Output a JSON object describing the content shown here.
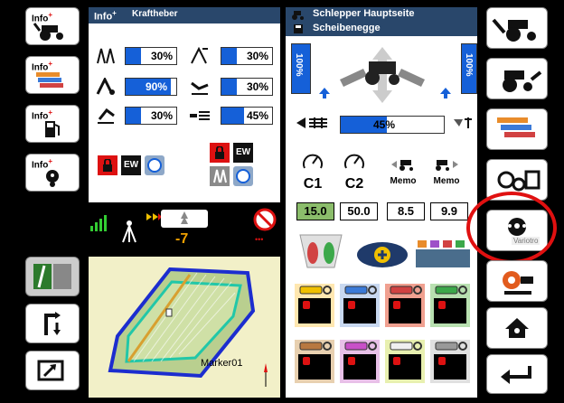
{
  "left_panel": {
    "info_label": "Info",
    "info_sup": "+",
    "title": "Kraftheber",
    "bars": [
      {
        "value": "30%",
        "fraction": 0.3
      },
      {
        "value": "90%",
        "fraction": 0.9
      },
      {
        "value": "30%",
        "fraction": 0.3
      },
      {
        "value": "30%",
        "fraction": 0.3
      },
      {
        "value": "30%",
        "fraction": 0.3
      },
      {
        "value": "45%",
        "fraction": 0.45
      }
    ],
    "ew_label": "EW",
    "ew_label_2": "EW"
  },
  "left_buttons": [
    {
      "label": "Info",
      "sup": "+"
    },
    {
      "label": "Info",
      "sup": "+"
    },
    {
      "label": "Info",
      "sup": "+"
    },
    {
      "label": "Info",
      "sup": "+"
    }
  ],
  "status": {
    "offset_value": "-7",
    "signal_icon": "signal-bars"
  },
  "map": {
    "marker_label": "Marker01"
  },
  "center_panel": {
    "title_1": "Schlepper Hauptseite",
    "title_2": "Scheibenegge",
    "left_vert_bar": "100%",
    "right_vert_bar": "100%",
    "draft_bar": {
      "value": "45%",
      "fraction": 0.45
    },
    "c1_label": "C1",
    "c2_label": "C2",
    "memo_1": "Memo",
    "memo_2": "Memo",
    "values": [
      "15.0",
      "50.0",
      "8.5",
      "9.9"
    ]
  },
  "right_buttons": {
    "tooltip": "Variotro"
  },
  "colors": {
    "header_blue": "#29476b",
    "bar_blue": "#1560d8",
    "highlight_red": "#e01010",
    "map_bg": "#f2f0c8"
  }
}
